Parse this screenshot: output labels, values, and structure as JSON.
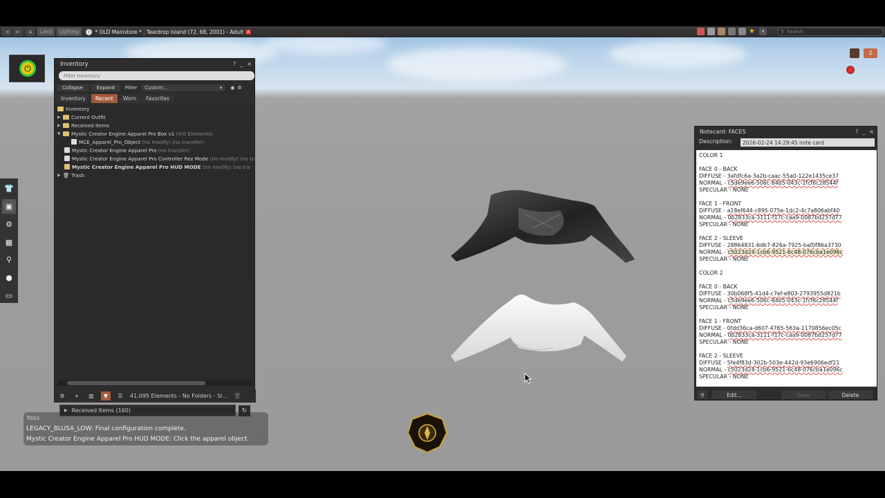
{
  "navbar": {
    "land_label": "Land",
    "lighting_label": "Lighting",
    "location": "* OLD Mainstore * , Teardrop Island (72, 68, 2001) - Adult",
    "adult_badge": "A",
    "search_placeholder": "Search"
  },
  "inventory": {
    "title": "Inventory",
    "help": "?",
    "minimize": "_",
    "close": "×",
    "filter_placeholder": "Filter Inventory",
    "actions": {
      "collapse": "Collapse",
      "expand": "Expand",
      "filter": "Filter",
      "custom": "Custom..."
    },
    "tabs": [
      "Inventory",
      "Recent",
      "Worn",
      "Favorites"
    ],
    "active_tab": "Recent",
    "tree": {
      "root": "Inventory",
      "current_outfit": "Current Outfit",
      "received_items": "Received Items",
      "box": "Mystic Creator Engine Apparel Pro Box v1",
      "box_count": "(4/0 Elements)",
      "item1": "MCE_Apparel_Pro_Object",
      "item1_perm": "(no modify) (no transfer)",
      "item2": "Mystic Creator Engine Apparel Pro",
      "item2_perm": "(no transfer)",
      "item3": "Mystic Creator Engine Apparel Pro Controller Rez Mode",
      "item3_perm": "(no modify) (no tra",
      "item4": "Mystic Creator Engine Apparel Pro HUD MODE",
      "item4_perm": "(no modify) (no tra",
      "trash": "Trash"
    },
    "status": "41.095 Elements - No Folders - Si..."
  },
  "conversation": {
    "received_items_label": "Received Items (160)"
  },
  "chat": {
    "line0": "Yoss",
    "line1": "LEGACY_BLUSA_LOW: Final configuration complete.",
    "line2": "Mystic Creator Engine Apparel Pro HUD MODE: Click the apparel object."
  },
  "notecard": {
    "title": "Notecard: FACES",
    "description_label": "Description:",
    "description_value": "2026-02-24 14:29:45 note card",
    "lines": [
      {
        "t": "COLOR 1"
      },
      {
        "t": ""
      },
      {
        "t": "FACE 0 - BACK"
      },
      {
        "p": "DIFFUSE - ",
        "u": "3afdfc6a-3a2b-caac-55a0-122e1435ce37"
      },
      {
        "p": "NORMAL - ",
        "u": "c5de9ee6-506c-84b5-043c-1fcf6c28544f"
      },
      {
        "t": "SPECULAR - NONE"
      },
      {
        "t": ""
      },
      {
        "t": "FACE 1 - FRONT"
      },
      {
        "p": "DIFFUSE - ",
        "u": "a18ef644-c895-075e-1dc2-4c7a806abf40"
      },
      {
        "p": "NORMAL - ",
        "u": "0b2833ca-3111-f17c-caa9-0087bd237d77"
      },
      {
        "t": "SPECULAR - NONE"
      },
      {
        "t": ""
      },
      {
        "t": "FACE 2 - SLEEVE"
      },
      {
        "p": "DIFFUSE - ",
        "u": "28864831-6db7-826a-7925-baf0f86a3730"
      },
      {
        "p": "NORMAL - ",
        "u": "c5023d24-1cb6-9521-6c48-076cba1e096c",
        "hl": true
      },
      {
        "t": "SPECULAR - NONE"
      },
      {
        "t": ""
      },
      {
        "t": "COLOR 2"
      },
      {
        "t": ""
      },
      {
        "t": "FACE 0 - BACK"
      },
      {
        "p": "DIFFUSE - ",
        "u": "30b068f5-41d4-c7ef-e803-2793955d821b"
      },
      {
        "p": "NORMAL - ",
        "u": "c5de9ee6-506c-84b5-043c-1fcf6c28544f"
      },
      {
        "t": "SPECULAR - NONE"
      },
      {
        "t": ""
      },
      {
        "t": "FACE 1 - FRONT"
      },
      {
        "p": "DIFFUSE - ",
        "u": "0fdd36ca-d607-4765-563a-1170856ec05c"
      },
      {
        "p": "NORMAL - ",
        "u": "0b2833ca-3111-f17c-caa9-0087bd237d77"
      },
      {
        "t": "SPECULAR - NONE"
      },
      {
        "t": ""
      },
      {
        "t": "FACE 2 - SLEEVE"
      },
      {
        "p": "DIFFUSE - ",
        "u": "5fe4f83d-302b-503e-442d-93e6906edf21"
      },
      {
        "p": "NORMAL - ",
        "u": "c5023d24-1cb6-9521-6c48-076cba1e096c"
      },
      {
        "t": "SPECULAR - NONE"
      }
    ],
    "edit_label": "Edit...",
    "save_label": "Save",
    "delete_label": "Delete"
  },
  "hud_counter": "2",
  "colors": {
    "accent": "#a35a3d",
    "panel": "#2d2d2d",
    "sky": "#b9d3ea",
    "ground": "#9e9e9e"
  },
  "icons": [
    "home-icon",
    "info-icon",
    "search-icon",
    "gear-icon",
    "power-icon",
    "star-icon",
    "folder-icon",
    "trash-icon",
    "refresh-icon"
  ]
}
